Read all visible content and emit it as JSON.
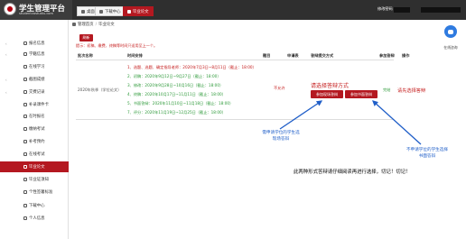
{
  "app": {
    "title": "学生管理平台",
    "url": "studentvastudiu.com"
  },
  "top_tabs": [
    {
      "label": "桌面",
      "icon": "desktop-icon"
    },
    {
      "label": "下载中心",
      "icon": "cloud-download-icon"
    },
    {
      "label": "毕业论文",
      "icon": "doc-icon"
    }
  ],
  "top_right": {
    "link": "修改密码"
  },
  "sidebar": [
    {
      "label": "报名信息"
    },
    {
      "label": "学籍信息"
    },
    {
      "label": "在线学习"
    },
    {
      "label": "截图成绩"
    },
    {
      "label": "交费记录"
    },
    {
      "label": "补录课件卡"
    },
    {
      "label": "在时报名"
    },
    {
      "label": "缴纳考试"
    },
    {
      "label": "补考预约"
    },
    {
      "label": "在线考试"
    },
    {
      "label": "毕业论文"
    },
    {
      "label": "毕业证须知"
    },
    {
      "label": "个性签署标准"
    },
    {
      "label": "下载中心"
    },
    {
      "label": "个人信息"
    }
  ],
  "breadcrumb": {
    "root": "管理首页",
    "current": "毕业论文"
  },
  "refresh_button": "刷新",
  "tip": "提示：初稿、缴费、终稿等时间只适用至上一个。",
  "table": {
    "headers": [
      "批次名称",
      "时间安排",
      "题目",
      "申请表",
      "答辩提交方式",
      "参加答辩",
      "操作"
    ],
    "row": {
      "batch": "2020年秋季（学位论文）",
      "schedule": [
        "1、选题、选题、确定指导老师：2020年7月3日~8月11日（截止：18:00）",
        "2、初稿：2020年9月12日~9月27日（截止：18:00）",
        "3、修改：2020年9月28日~10月16日（截止：18:00）",
        "4、终稿：2020年10月17日~11月11日（截止：18:00）",
        "5、书面答辩：2020年11月10日~11月18日（截止：18:00）",
        "7、评分：2020年11月19日~12月25日（截止：18:00）"
      ],
      "status": "不允许",
      "btn_onsite": "参加现场答辩",
      "btn_written": "参加书面答辩",
      "finish": "完结"
    }
  },
  "annotations": {
    "choose_method": "请选择答辩方式",
    "choose_right": "请先选择答辩",
    "onsite_note": [
      "需申请学位的学生选",
      "现场答辩"
    ],
    "written_note": [
      "不申请学位的学生选择",
      "书面答辩"
    ],
    "notice": "此两种形式答辩请仔细阅读再进行选择，切记！切记！"
  },
  "help": {
    "label": "在线咨询"
  },
  "colors": {
    "brand_red": "#b41820",
    "header": "#2f2f2f",
    "annotation_blue": "#1f5ec8",
    "green": "#2e9a3a"
  }
}
